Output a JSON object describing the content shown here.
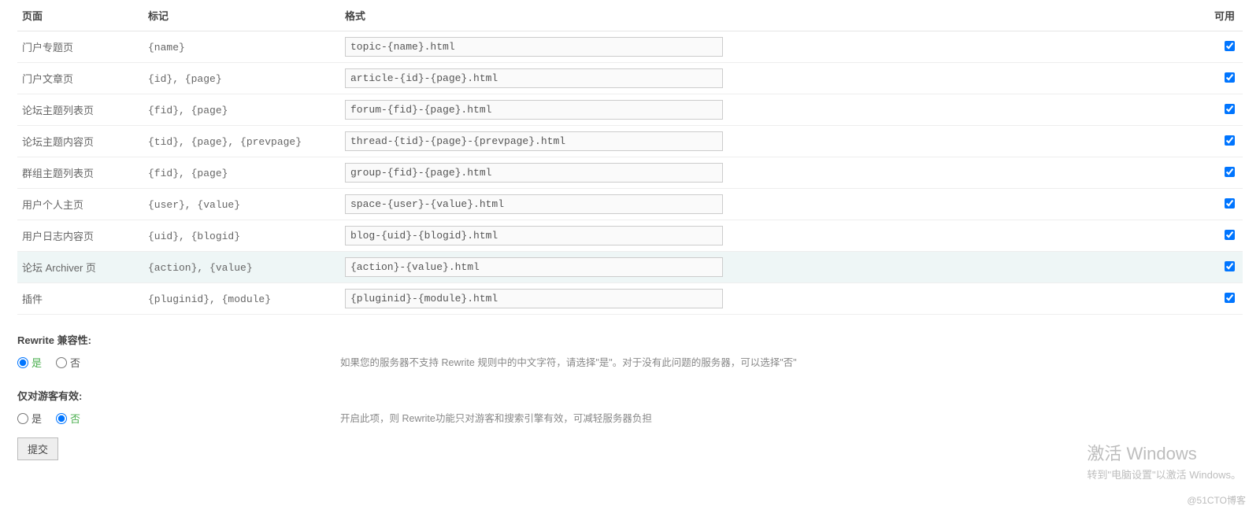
{
  "table": {
    "headers": {
      "page": "页面",
      "tag": "标记",
      "format": "格式",
      "avail": "可用"
    },
    "rows": [
      {
        "page": "门户专题页",
        "tag": "{name}",
        "format": "topic-{name}.html",
        "checked": true,
        "hl": false
      },
      {
        "page": "门户文章页",
        "tag": "{id}, {page}",
        "format": "article-{id}-{page}.html",
        "checked": true,
        "hl": false
      },
      {
        "page": "论坛主题列表页",
        "tag": "{fid}, {page}",
        "format": "forum-{fid}-{page}.html",
        "checked": true,
        "hl": false
      },
      {
        "page": "论坛主题内容页",
        "tag": "{tid}, {page}, {prevpage}",
        "format": "thread-{tid}-{page}-{prevpage}.html",
        "checked": true,
        "hl": false
      },
      {
        "page": "群组主题列表页",
        "tag": "{fid}, {page}",
        "format": "group-{fid}-{page}.html",
        "checked": true,
        "hl": false
      },
      {
        "page": "用户个人主页",
        "tag": "{user}, {value}",
        "format": "space-{user}-{value}.html",
        "checked": true,
        "hl": false
      },
      {
        "page": "用户日志内容页",
        "tag": "{uid}, {blogid}",
        "format": "blog-{uid}-{blogid}.html",
        "checked": true,
        "hl": false
      },
      {
        "page": "论坛 Archiver 页",
        "tag": "{action}, {value}",
        "format": "{action}-{value}.html",
        "checked": true,
        "hl": true
      },
      {
        "page": "插件",
        "tag": "{pluginid}, {module}",
        "format": "{pluginid}-{module}.html",
        "checked": true,
        "hl": false
      }
    ]
  },
  "compat": {
    "title": "Rewrite 兼容性:",
    "yes": "是",
    "no": "否",
    "selected": "yes",
    "help": "如果您的服务器不支持 Rewrite 规则中的中文字符，请选择\"是\"。对于没有此问题的服务器，可以选择\"否\""
  },
  "guest": {
    "title": "仅对游客有效:",
    "yes": "是",
    "no": "否",
    "selected": "no",
    "help": "开启此项，则 Rewrite功能只对游客和搜索引擎有效，可减轻服务器负担"
  },
  "submit_label": "提交",
  "watermark": {
    "line1": "激活 Windows",
    "line2": "转到\"电脑设置\"以激活 Windows。",
    "blog": "@51CTO博客"
  }
}
